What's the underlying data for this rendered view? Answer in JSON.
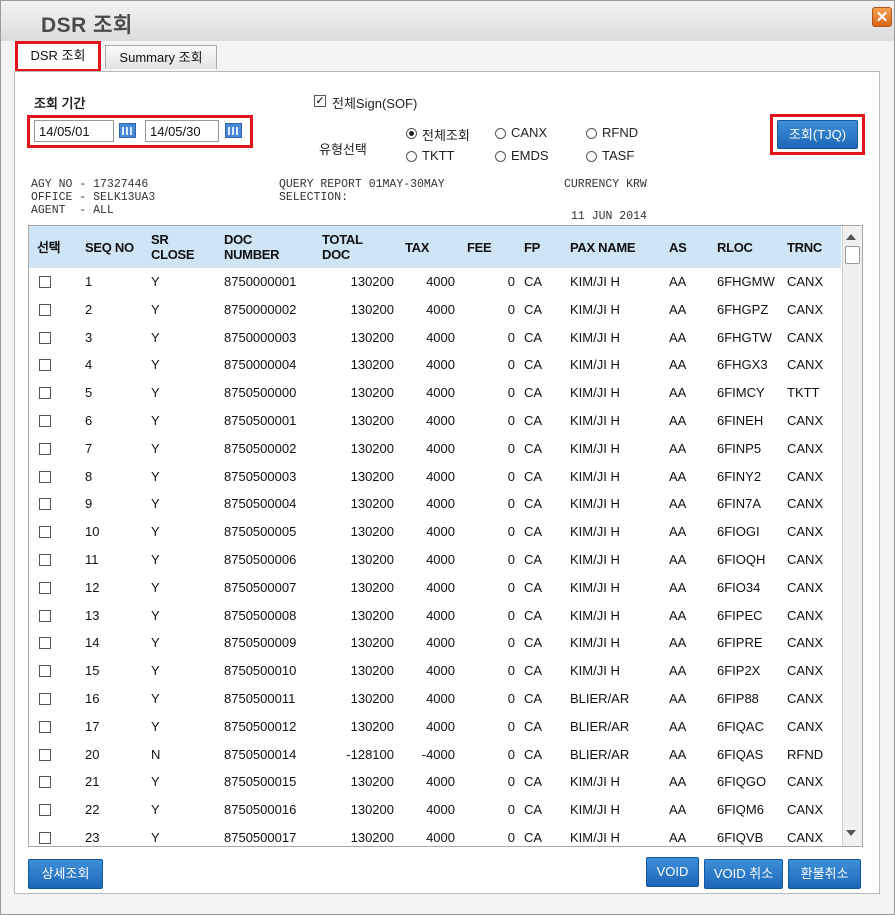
{
  "window": {
    "title": "DSR 조회"
  },
  "tabs": [
    {
      "label": "DSR 조회",
      "active": true
    },
    {
      "label": "Summary 조회",
      "active": false
    }
  ],
  "query": {
    "period_label": "조회 기간",
    "date_from": "14/05/01",
    "date_to": "14/05/30",
    "sign_checkbox_label": "전체Sign(SOF)",
    "sign_checked": true,
    "type_label": "유형선택",
    "type_options": [
      {
        "label": "전체조회",
        "selected": true
      },
      {
        "label": "CANX",
        "selected": false
      },
      {
        "label": "RFND",
        "selected": false
      },
      {
        "label": "TKTT",
        "selected": false
      },
      {
        "label": "EMDS",
        "selected": false
      },
      {
        "label": "TASF",
        "selected": false
      }
    ],
    "search_button": "조회(TJQ)"
  },
  "report_header": {
    "agy_no": "AGY NO - 17327446",
    "office": "OFFICE - SELK13UA3",
    "agent": "AGENT  - ALL",
    "query_report": "QUERY REPORT 01MAY-30MAY",
    "selection": "SELECTION:",
    "currency": "CURRENCY KRW",
    "date": "11 JUN 2014"
  },
  "table": {
    "columns": [
      {
        "key": "select",
        "label": "선택"
      },
      {
        "key": "seq",
        "label": "SEQ NO"
      },
      {
        "key": "sr_close",
        "label": "SR\nCLOSE"
      },
      {
        "key": "doc",
        "label": "DOC\nNUMBER"
      },
      {
        "key": "total",
        "label": "TOTAL\nDOC"
      },
      {
        "key": "tax",
        "label": "TAX"
      },
      {
        "key": "fee",
        "label": "FEE"
      },
      {
        "key": "fp",
        "label": "FP"
      },
      {
        "key": "pax",
        "label": "PAX NAME"
      },
      {
        "key": "as",
        "label": "AS"
      },
      {
        "key": "rloc",
        "label": "RLOC"
      },
      {
        "key": "trnc",
        "label": "TRNC"
      }
    ],
    "rows": [
      {
        "seq": "1",
        "sr_close": "Y",
        "doc": "8750000001",
        "total": "130200",
        "tax": "4000",
        "fee": "0",
        "fp": "CA",
        "pax": "KIM/JI H",
        "as": "AA",
        "rloc": "6FHGMW",
        "trnc": "CANX"
      },
      {
        "seq": "2",
        "sr_close": "Y",
        "doc": "8750000002",
        "total": "130200",
        "tax": "4000",
        "fee": "0",
        "fp": "CA",
        "pax": "KIM/JI H",
        "as": "AA",
        "rloc": "6FHGPZ",
        "trnc": "CANX"
      },
      {
        "seq": "3",
        "sr_close": "Y",
        "doc": "8750000003",
        "total": "130200",
        "tax": "4000",
        "fee": "0",
        "fp": "CA",
        "pax": "KIM/JI H",
        "as": "AA",
        "rloc": "6FHGTW",
        "trnc": "CANX"
      },
      {
        "seq": "4",
        "sr_close": "Y",
        "doc": "8750000004",
        "total": "130200",
        "tax": "4000",
        "fee": "0",
        "fp": "CA",
        "pax": "KIM/JI H",
        "as": "AA",
        "rloc": "6FHGX3",
        "trnc": "CANX"
      },
      {
        "seq": "5",
        "sr_close": "Y",
        "doc": "8750500000",
        "total": "130200",
        "tax": "4000",
        "fee": "0",
        "fp": "CA",
        "pax": "KIM/JI H",
        "as": "AA",
        "rloc": "6FIMCY",
        "trnc": "TKTT"
      },
      {
        "seq": "6",
        "sr_close": "Y",
        "doc": "8750500001",
        "total": "130200",
        "tax": "4000",
        "fee": "0",
        "fp": "CA",
        "pax": "KIM/JI H",
        "as": "AA",
        "rloc": "6FINEH",
        "trnc": "CANX"
      },
      {
        "seq": "7",
        "sr_close": "Y",
        "doc": "8750500002",
        "total": "130200",
        "tax": "4000",
        "fee": "0",
        "fp": "CA",
        "pax": "KIM/JI H",
        "as": "AA",
        "rloc": "6FINP5",
        "trnc": "CANX"
      },
      {
        "seq": "8",
        "sr_close": "Y",
        "doc": "8750500003",
        "total": "130200",
        "tax": "4000",
        "fee": "0",
        "fp": "CA",
        "pax": "KIM/JI H",
        "as": "AA",
        "rloc": "6FINY2",
        "trnc": "CANX"
      },
      {
        "seq": "9",
        "sr_close": "Y",
        "doc": "8750500004",
        "total": "130200",
        "tax": "4000",
        "fee": "0",
        "fp": "CA",
        "pax": "KIM/JI H",
        "as": "AA",
        "rloc": "6FIN7A",
        "trnc": "CANX"
      },
      {
        "seq": "10",
        "sr_close": "Y",
        "doc": "8750500005",
        "total": "130200",
        "tax": "4000",
        "fee": "0",
        "fp": "CA",
        "pax": "KIM/JI H",
        "as": "AA",
        "rloc": "6FIOGI",
        "trnc": "CANX"
      },
      {
        "seq": "11",
        "sr_close": "Y",
        "doc": "8750500006",
        "total": "130200",
        "tax": "4000",
        "fee": "0",
        "fp": "CA",
        "pax": "KIM/JI H",
        "as": "AA",
        "rloc": "6FIOQH",
        "trnc": "CANX"
      },
      {
        "seq": "12",
        "sr_close": "Y",
        "doc": "8750500007",
        "total": "130200",
        "tax": "4000",
        "fee": "0",
        "fp": "CA",
        "pax": "KIM/JI H",
        "as": "AA",
        "rloc": "6FIO34",
        "trnc": "CANX"
      },
      {
        "seq": "13",
        "sr_close": "Y",
        "doc": "8750500008",
        "total": "130200",
        "tax": "4000",
        "fee": "0",
        "fp": "CA",
        "pax": "KIM/JI H",
        "as": "AA",
        "rloc": "6FIPEC",
        "trnc": "CANX"
      },
      {
        "seq": "14",
        "sr_close": "Y",
        "doc": "8750500009",
        "total": "130200",
        "tax": "4000",
        "fee": "0",
        "fp": "CA",
        "pax": "KIM/JI H",
        "as": "AA",
        "rloc": "6FIPRE",
        "trnc": "CANX"
      },
      {
        "seq": "15",
        "sr_close": "Y",
        "doc": "8750500010",
        "total": "130200",
        "tax": "4000",
        "fee": "0",
        "fp": "CA",
        "pax": "KIM/JI H",
        "as": "AA",
        "rloc": "6FIP2X",
        "trnc": "CANX"
      },
      {
        "seq": "16",
        "sr_close": "Y",
        "doc": "8750500011",
        "total": "130200",
        "tax": "4000",
        "fee": "0",
        "fp": "CA",
        "pax": "BLIER/AR",
        "as": "AA",
        "rloc": "6FIP88",
        "trnc": "CANX"
      },
      {
        "seq": "17",
        "sr_close": "Y",
        "doc": "8750500012",
        "total": "130200",
        "tax": "4000",
        "fee": "0",
        "fp": "CA",
        "pax": "BLIER/AR",
        "as": "AA",
        "rloc": "6FIQAC",
        "trnc": "CANX"
      },
      {
        "seq": "20",
        "sr_close": "N",
        "doc": "8750500014",
        "total": "-128100",
        "tax": "-4000",
        "fee": "0",
        "fp": "CA",
        "pax": "BLIER/AR",
        "as": "AA",
        "rloc": "6FIQAS",
        "trnc": "RFND"
      },
      {
        "seq": "21",
        "sr_close": "Y",
        "doc": "8750500015",
        "total": "130200",
        "tax": "4000",
        "fee": "0",
        "fp": "CA",
        "pax": "KIM/JI H",
        "as": "AA",
        "rloc": "6FIQGO",
        "trnc": "CANX"
      },
      {
        "seq": "22",
        "sr_close": "Y",
        "doc": "8750500016",
        "total": "130200",
        "tax": "4000",
        "fee": "0",
        "fp": "CA",
        "pax": "KIM/JI H",
        "as": "AA",
        "rloc": "6FIQM6",
        "trnc": "CANX"
      },
      {
        "seq": "23",
        "sr_close": "Y",
        "doc": "8750500017",
        "total": "130200",
        "tax": "4000",
        "fee": "0",
        "fp": "CA",
        "pax": "KIM/JI H",
        "as": "AA",
        "rloc": "6FIQVB",
        "trnc": "CANX"
      }
    ]
  },
  "footer": {
    "detail_button": "상세조회",
    "void_button": "VOID",
    "void_cancel_button": "VOID 취소",
    "refund_cancel_button": "환불취소"
  },
  "colors": {
    "header_bg": "#cfe4f5",
    "button_blue": "#1d67b8",
    "highlight_red": "#e3151b",
    "close_orange": "#e07a2a"
  },
  "icons": {
    "close": "close-icon",
    "calendar": "calendar-icon"
  }
}
